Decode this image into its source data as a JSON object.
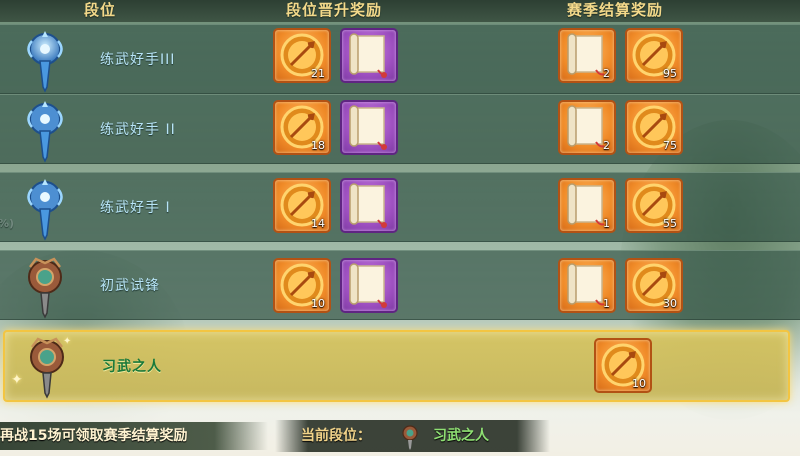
{
  "header": {
    "rank_col": "段位",
    "promo_col": "段位晋升奖励",
    "season_col": "赛季结算奖励"
  },
  "side_label": "%)",
  "rows": [
    {
      "name": "练武好手III",
      "emblem": "blue-sword-emblem",
      "promo": [
        {
          "icon": "gold-coin-sword-icon",
          "count": "21"
        },
        {
          "icon": "scroll-icon",
          "count": ""
        }
      ],
      "season": [
        {
          "icon": "scroll-icon",
          "count": "2"
        },
        {
          "icon": "gold-coin-sword-icon",
          "count": "95"
        }
      ]
    },
    {
      "name": "练武好手 II",
      "emblem": "blue-sword-emblem",
      "promo": [
        {
          "icon": "gold-coin-sword-icon",
          "count": "18"
        },
        {
          "icon": "scroll-icon",
          "count": ""
        }
      ],
      "season": [
        {
          "icon": "scroll-icon",
          "count": "2"
        },
        {
          "icon": "gold-coin-sword-icon",
          "count": "75"
        }
      ]
    },
    {
      "name": "练武好手 I",
      "emblem": "blue-sword-emblem",
      "promo": [
        {
          "icon": "gold-coin-sword-icon",
          "count": "14"
        },
        {
          "icon": "scroll-icon",
          "count": ""
        }
      ],
      "season": [
        {
          "icon": "scroll-icon",
          "count": "1"
        },
        {
          "icon": "gold-coin-sword-icon",
          "count": "55"
        }
      ]
    },
    {
      "name": "初武试锋",
      "emblem": "bronze-sword-emblem",
      "promo": [
        {
          "icon": "gold-coin-sword-icon",
          "count": "10"
        },
        {
          "icon": "scroll-icon",
          "count": ""
        }
      ],
      "season": [
        {
          "icon": "scroll-icon",
          "count": "1"
        },
        {
          "icon": "gold-coin-sword-icon",
          "count": "30"
        }
      ]
    },
    {
      "name": "习武之人",
      "emblem": "bronze-sword-emblem",
      "current": true,
      "promo": [],
      "season": [
        {
          "icon": "gold-coin-sword-icon",
          "count": "10"
        }
      ]
    }
  ],
  "footer": {
    "hint": "再战15场可领取赛季结算奖励",
    "current_label": "当前段位：",
    "current_value": "习武之人"
  },
  "colors": {
    "header_text": "#f3d98a",
    "rank_text": "#b7e4f6",
    "current_rank_text": "#19793a",
    "highlight_border": "#f3c542"
  }
}
